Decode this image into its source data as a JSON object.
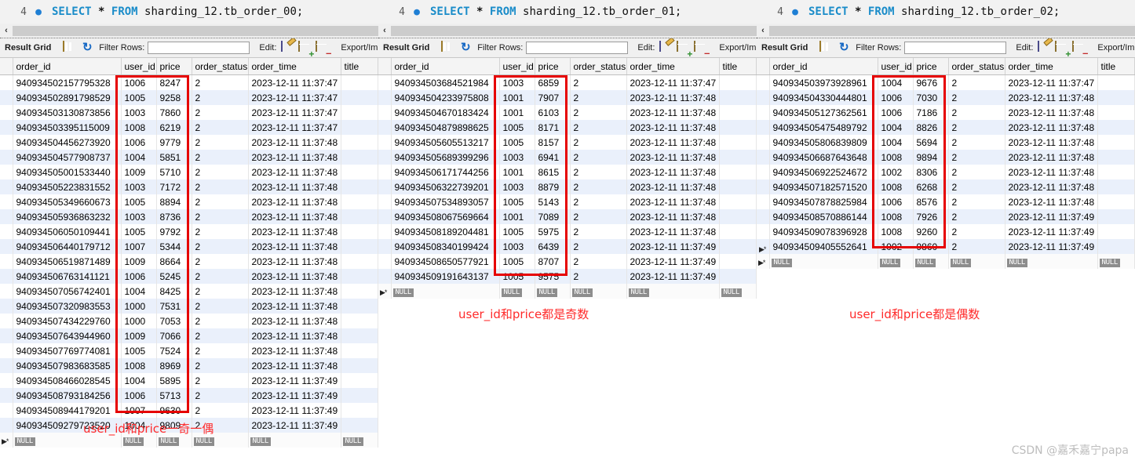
{
  "watermark": "CSDN @嘉禾嘉宁papa",
  "toolbar": {
    "result_grid_label": "Result Grid",
    "filter_rows_label": "Filter Rows:",
    "filter_placeholder": "",
    "filter_value": "",
    "edit_label": "Edit:",
    "export_import_label": "Export/Import:",
    "grid_icon": "grid-icon",
    "refresh_icon": "refresh-icon",
    "edit_icon": "pencil-icon",
    "add_row_icon": "add-row-icon",
    "delete_row_icon": "delete-row-icon"
  },
  "columns": [
    "order_id",
    "user_id",
    "price",
    "order_status",
    "order_time",
    "title"
  ],
  "null_label": "NULL",
  "scroll_arrow": "‹",
  "panels": [
    {
      "line_number": "4",
      "sql_keyword_1": "SELECT",
      "sql_star": "*",
      "sql_keyword_2": "FROM",
      "sql_table": "sharding_12.tb_order_00;",
      "caption": "user_id和price一奇一偶",
      "rows": [
        {
          "order_id": "940934502157795328",
          "user_id": "1006",
          "price": "8247",
          "order_status": "2",
          "order_time": "2023-12-11 11:37:47",
          "title": ""
        },
        {
          "order_id": "940934502891798529",
          "user_id": "1005",
          "price": "9258",
          "order_status": "2",
          "order_time": "2023-12-11 11:37:47",
          "title": ""
        },
        {
          "order_id": "940934503130873856",
          "user_id": "1003",
          "price": "7860",
          "order_status": "2",
          "order_time": "2023-12-11 11:37:47",
          "title": ""
        },
        {
          "order_id": "940934503395115009",
          "user_id": "1008",
          "price": "6219",
          "order_status": "2",
          "order_time": "2023-12-11 11:37:47",
          "title": ""
        },
        {
          "order_id": "940934504456273920",
          "user_id": "1006",
          "price": "9779",
          "order_status": "2",
          "order_time": "2023-12-11 11:37:48",
          "title": ""
        },
        {
          "order_id": "940934504577908737",
          "user_id": "1004",
          "price": "5851",
          "order_status": "2",
          "order_time": "2023-12-11 11:37:48",
          "title": ""
        },
        {
          "order_id": "940934505001533440",
          "user_id": "1009",
          "price": "5710",
          "order_status": "2",
          "order_time": "2023-12-11 11:37:48",
          "title": ""
        },
        {
          "order_id": "940934505223831552",
          "user_id": "1003",
          "price": "7172",
          "order_status": "2",
          "order_time": "2023-12-11 11:37:48",
          "title": ""
        },
        {
          "order_id": "940934505349660673",
          "user_id": "1005",
          "price": "8894",
          "order_status": "2",
          "order_time": "2023-12-11 11:37:48",
          "title": ""
        },
        {
          "order_id": "940934505936863232",
          "user_id": "1003",
          "price": "8736",
          "order_status": "2",
          "order_time": "2023-12-11 11:37:48",
          "title": ""
        },
        {
          "order_id": "940934506050109441",
          "user_id": "1005",
          "price": "9792",
          "order_status": "2",
          "order_time": "2023-12-11 11:37:48",
          "title": ""
        },
        {
          "order_id": "940934506440179712",
          "user_id": "1007",
          "price": "5344",
          "order_status": "2",
          "order_time": "2023-12-11 11:37:48",
          "title": ""
        },
        {
          "order_id": "940934506519871489",
          "user_id": "1009",
          "price": "8664",
          "order_status": "2",
          "order_time": "2023-12-11 11:37:48",
          "title": ""
        },
        {
          "order_id": "940934506763141121",
          "user_id": "1006",
          "price": "5245",
          "order_status": "2",
          "order_time": "2023-12-11 11:37:48",
          "title": ""
        },
        {
          "order_id": "940934507056742401",
          "user_id": "1004",
          "price": "8425",
          "order_status": "2",
          "order_time": "2023-12-11 11:37:48",
          "title": ""
        },
        {
          "order_id": "940934507320983553",
          "user_id": "1000",
          "price": "7531",
          "order_status": "2",
          "order_time": "2023-12-11 11:37:48",
          "title": ""
        },
        {
          "order_id": "940934507434229760",
          "user_id": "1000",
          "price": "7053",
          "order_status": "2",
          "order_time": "2023-12-11 11:37:48",
          "title": ""
        },
        {
          "order_id": "940934507643944960",
          "user_id": "1009",
          "price": "7066",
          "order_status": "2",
          "order_time": "2023-12-11 11:37:48",
          "title": ""
        },
        {
          "order_id": "940934507769774081",
          "user_id": "1005",
          "price": "7524",
          "order_status": "2",
          "order_time": "2023-12-11 11:37:48",
          "title": ""
        },
        {
          "order_id": "940934507983683585",
          "user_id": "1008",
          "price": "8969",
          "order_status": "2",
          "order_time": "2023-12-11 11:37:48",
          "title": ""
        },
        {
          "order_id": "940934508466028545",
          "user_id": "1004",
          "price": "5895",
          "order_status": "2",
          "order_time": "2023-12-11 11:37:49",
          "title": ""
        },
        {
          "order_id": "940934508793184256",
          "user_id": "1006",
          "price": "5713",
          "order_status": "2",
          "order_time": "2023-12-11 11:37:49",
          "title": ""
        },
        {
          "order_id": "940934508944179201",
          "user_id": "1007",
          "price": "9630",
          "order_status": "2",
          "order_time": "2023-12-11 11:37:49",
          "title": ""
        },
        {
          "order_id": "940934509279723520",
          "user_id": "1004",
          "price": "9809",
          "order_status": "2",
          "order_time": "2023-12-11 11:37:49",
          "title": ""
        }
      ]
    },
    {
      "line_number": "4",
      "sql_keyword_1": "SELECT",
      "sql_star": "*",
      "sql_keyword_2": "FROM",
      "sql_table": "sharding_12.tb_order_01;",
      "caption": "user_id和price都是奇数",
      "rows": [
        {
          "order_id": "940934503684521984",
          "user_id": "1003",
          "price": "6859",
          "order_status": "2",
          "order_time": "2023-12-11 11:37:47",
          "title": ""
        },
        {
          "order_id": "940934504233975808",
          "user_id": "1001",
          "price": "7907",
          "order_status": "2",
          "order_time": "2023-12-11 11:37:48",
          "title": ""
        },
        {
          "order_id": "940934504670183424",
          "user_id": "1001",
          "price": "6103",
          "order_status": "2",
          "order_time": "2023-12-11 11:37:48",
          "title": ""
        },
        {
          "order_id": "940934504879898625",
          "user_id": "1005",
          "price": "8171",
          "order_status": "2",
          "order_time": "2023-12-11 11:37:48",
          "title": ""
        },
        {
          "order_id": "940934505605513217",
          "user_id": "1005",
          "price": "8157",
          "order_status": "2",
          "order_time": "2023-12-11 11:37:48",
          "title": ""
        },
        {
          "order_id": "940934505689399296",
          "user_id": "1003",
          "price": "6941",
          "order_status": "2",
          "order_time": "2023-12-11 11:37:48",
          "title": ""
        },
        {
          "order_id": "940934506171744256",
          "user_id": "1001",
          "price": "8615",
          "order_status": "2",
          "order_time": "2023-12-11 11:37:48",
          "title": ""
        },
        {
          "order_id": "940934506322739201",
          "user_id": "1003",
          "price": "8879",
          "order_status": "2",
          "order_time": "2023-12-11 11:37:48",
          "title": ""
        },
        {
          "order_id": "940934507534893057",
          "user_id": "1005",
          "price": "5143",
          "order_status": "2",
          "order_time": "2023-12-11 11:37:48",
          "title": ""
        },
        {
          "order_id": "940934508067569664",
          "user_id": "1001",
          "price": "7089",
          "order_status": "2",
          "order_time": "2023-12-11 11:37:48",
          "title": ""
        },
        {
          "order_id": "940934508189204481",
          "user_id": "1005",
          "price": "5975",
          "order_status": "2",
          "order_time": "2023-12-11 11:37:48",
          "title": ""
        },
        {
          "order_id": "940934508340199424",
          "user_id": "1003",
          "price": "6439",
          "order_status": "2",
          "order_time": "2023-12-11 11:37:49",
          "title": ""
        },
        {
          "order_id": "940934508650577921",
          "user_id": "1005",
          "price": "8707",
          "order_status": "2",
          "order_time": "2023-12-11 11:37:49",
          "title": ""
        },
        {
          "order_id": "940934509191643137",
          "user_id": "1005",
          "price": "9575",
          "order_status": "2",
          "order_time": "2023-12-11 11:37:49",
          "title": ""
        }
      ]
    },
    {
      "line_number": "4",
      "sql_keyword_1": "SELECT",
      "sql_star": "*",
      "sql_keyword_2": "FROM",
      "sql_table": "sharding_12.tb_order_02;",
      "caption": "user_id和price都是偶数",
      "rows": [
        {
          "order_id": "940934503973928961",
          "user_id": "1004",
          "price": "9676",
          "order_status": "2",
          "order_time": "2023-12-11 11:37:47",
          "title": ""
        },
        {
          "order_id": "940934504330444801",
          "user_id": "1006",
          "price": "7030",
          "order_status": "2",
          "order_time": "2023-12-11 11:37:48",
          "title": ""
        },
        {
          "order_id": "940934505127362561",
          "user_id": "1006",
          "price": "7186",
          "order_status": "2",
          "order_time": "2023-12-11 11:37:48",
          "title": ""
        },
        {
          "order_id": "940934505475489792",
          "user_id": "1004",
          "price": "8826",
          "order_status": "2",
          "order_time": "2023-12-11 11:37:48",
          "title": ""
        },
        {
          "order_id": "940934505806839809",
          "user_id": "1004",
          "price": "5694",
          "order_status": "2",
          "order_time": "2023-12-11 11:37:48",
          "title": ""
        },
        {
          "order_id": "940934506687643648",
          "user_id": "1008",
          "price": "9894",
          "order_status": "2",
          "order_time": "2023-12-11 11:37:48",
          "title": ""
        },
        {
          "order_id": "940934506922524672",
          "user_id": "1002",
          "price": "8306",
          "order_status": "2",
          "order_time": "2023-12-11 11:37:48",
          "title": ""
        },
        {
          "order_id": "940934507182571520",
          "user_id": "1008",
          "price": "6268",
          "order_status": "2",
          "order_time": "2023-12-11 11:37:48",
          "title": ""
        },
        {
          "order_id": "940934507878825984",
          "user_id": "1006",
          "price": "8576",
          "order_status": "2",
          "order_time": "2023-12-11 11:37:48",
          "title": ""
        },
        {
          "order_id": "940934508570886144",
          "user_id": "1008",
          "price": "7926",
          "order_status": "2",
          "order_time": "2023-12-11 11:37:49",
          "title": ""
        },
        {
          "order_id": "940934509078396928",
          "user_id": "1008",
          "price": "9260",
          "order_status": "2",
          "order_time": "2023-12-11 11:37:49",
          "title": ""
        },
        {
          "order_id": "940934509405552641",
          "user_id": "1002",
          "price": "9860",
          "order_status": "2",
          "order_time": "2023-12-11 11:37:49",
          "title": ""
        }
      ]
    }
  ]
}
